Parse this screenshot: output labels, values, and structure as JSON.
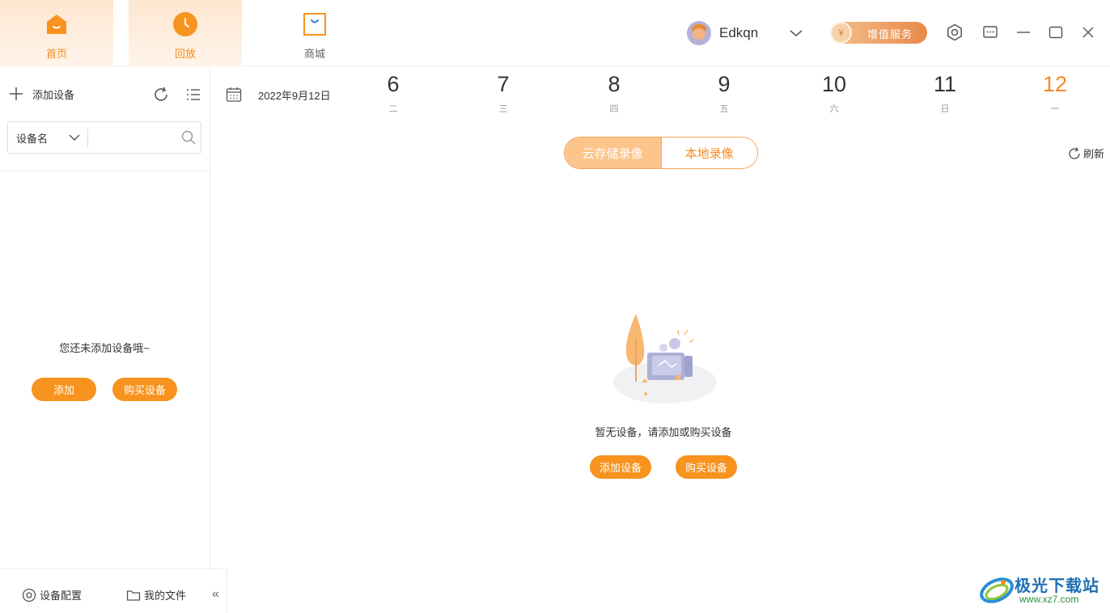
{
  "nav": {
    "tabs": [
      {
        "label": "首页",
        "icon": "home-icon",
        "active": true
      },
      {
        "label": "回放",
        "icon": "clock-icon",
        "active": true
      },
      {
        "label": "商城",
        "icon": "shopping-bag-icon",
        "active": false
      }
    ]
  },
  "user": {
    "name": "Edkqn",
    "avatar": "user-avatar"
  },
  "vip": {
    "coin": "¥",
    "label": "增值服务"
  },
  "sidebar": {
    "add_device_label": "添加设备",
    "search": {
      "select_value": "设备名",
      "placeholder": ""
    },
    "empty_text": "您还未添加设备哦~",
    "add_button": "添加",
    "buy_button": "购买设备",
    "footer": {
      "config_label": "设备配置",
      "files_label": "我的文件",
      "collapse": "«"
    }
  },
  "main": {
    "date": "2022年9月12日",
    "days": [
      {
        "num": "6",
        "weekday": "二"
      },
      {
        "num": "7",
        "weekday": "三"
      },
      {
        "num": "8",
        "weekday": "四"
      },
      {
        "num": "9",
        "weekday": "五"
      },
      {
        "num": "10",
        "weekday": "六"
      },
      {
        "num": "11",
        "weekday": "日"
      },
      {
        "num": "12",
        "weekday": "一",
        "selected": true
      }
    ],
    "segments": {
      "cloud": "云存储录像",
      "local": "本地录像",
      "active": "cloud"
    },
    "refresh_label": "刷新",
    "empty_text": "暂无设备，请添加或购买设备",
    "add_button": "添加设备",
    "buy_button": "购买设备"
  },
  "watermark": {
    "title": "极光下载站",
    "url": "www.xz7.com"
  },
  "colors": {
    "accent": "#f7931e",
    "accent_light": "#fcc58c",
    "border": "#ececec"
  }
}
